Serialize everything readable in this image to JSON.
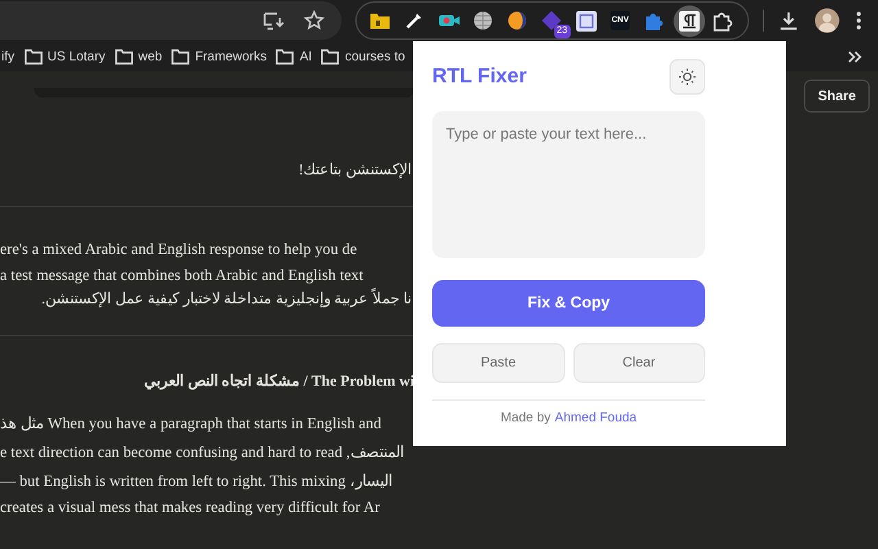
{
  "extensions": [
    {
      "kind": "folder",
      "selected": false
    },
    {
      "kind": "pipette",
      "selected": false
    },
    {
      "kind": "camera",
      "selected": false
    },
    {
      "kind": "globe",
      "selected": false
    },
    {
      "kind": "moon",
      "selected": false
    },
    {
      "kind": "diamond",
      "selected": false,
      "badge": "23"
    },
    {
      "kind": "frame",
      "selected": false
    },
    {
      "kind": "tag",
      "selected": false,
      "label": "CNV"
    },
    {
      "kind": "puzzle",
      "selected": false
    },
    {
      "kind": "pilcrow",
      "selected": true
    },
    {
      "kind": "manage",
      "selected": false
    }
  ],
  "bookmarks": [
    {
      "label": "ify",
      "kind": "text"
    },
    {
      "label": "US Lotary",
      "kind": "folder"
    },
    {
      "label": "web",
      "kind": "folder"
    },
    {
      "label": "Frameworks",
      "kind": "folder"
    },
    {
      "label": "AI",
      "kind": "folder"
    },
    {
      "label": "courses to",
      "kind": "folder"
    }
  ],
  "share_button": "Share",
  "page": [
    {
      "kind": "rtl",
      "text": "الإكستنشن بتاعتك!"
    },
    {
      "kind": "rule"
    },
    {
      "kind": "ltr",
      "text": "ere's a mixed Arabic and English response to help you de"
    },
    {
      "kind": "ltr",
      "text": "a test message that combines both Arabic and English text"
    },
    {
      "kind": "rtl",
      "text": "نا جملاً عربية وإنجليزية متداخلة لاختبار كيفية عمل الإكستنشن."
    },
    {
      "kind": "rule"
    },
    {
      "kind": "heading",
      "text": "مشكلة اتجاه النص العربي / The Problem wi"
    },
    {
      "kind": "ltr",
      "text": "مثل هذ When you have a paragraph that starts in English and"
    },
    {
      "kind": "ltr",
      "text": "e text direction can become confusing and hard to read ,المنتصف"
    },
    {
      "kind": "ltr",
      "text": "— but English is written from left to right. This mixing ،اليسار"
    },
    {
      "kind": "ltr",
      "text": "creates a visual mess that makes reading very difficult for Ar"
    }
  ],
  "popup": {
    "title": "RTL Fixer",
    "input": {
      "placeholder": "Type or paste your text here..."
    },
    "primary_button": "Fix & Copy",
    "buttons": [
      "Paste",
      "Clear"
    ],
    "footer": {
      "text": "Made by",
      "link": "Ahmed Fouda"
    }
  }
}
